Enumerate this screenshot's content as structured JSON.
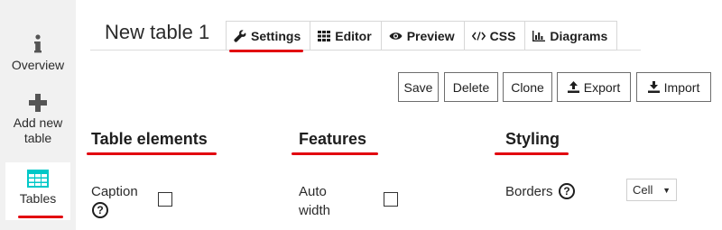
{
  "sidebar": {
    "items": [
      {
        "label": "Overview",
        "icon": "info-icon"
      },
      {
        "label": "Add new table",
        "icon": "plus-icon"
      },
      {
        "label": "Tables",
        "icon": "table-grid-icon"
      }
    ],
    "active_color": "#00c8c8",
    "accent_color": "#e2000f"
  },
  "header": {
    "title": "New table 1",
    "tabs": [
      {
        "label": "Settings",
        "icon": "wrench-icon",
        "active": true
      },
      {
        "label": "Editor",
        "icon": "grid-icon"
      },
      {
        "label": "Preview",
        "icon": "eye-icon"
      },
      {
        "label": "CSS",
        "icon": "code-icon"
      },
      {
        "label": "Diagrams",
        "icon": "bar-chart-icon"
      }
    ]
  },
  "actions": {
    "save": "Save",
    "delete": "Delete",
    "clone": "Clone",
    "export": "Export",
    "import": "Import"
  },
  "sections": {
    "table_elements": {
      "heading": "Table elements",
      "caption_label": "Caption",
      "caption_checked": false
    },
    "features": {
      "heading": "Features",
      "auto_width_label": "Auto width",
      "auto_width_checked": false
    },
    "styling": {
      "heading": "Styling",
      "borders_label": "Borders",
      "borders_value": "Cell"
    },
    "help_glyph": "?"
  }
}
